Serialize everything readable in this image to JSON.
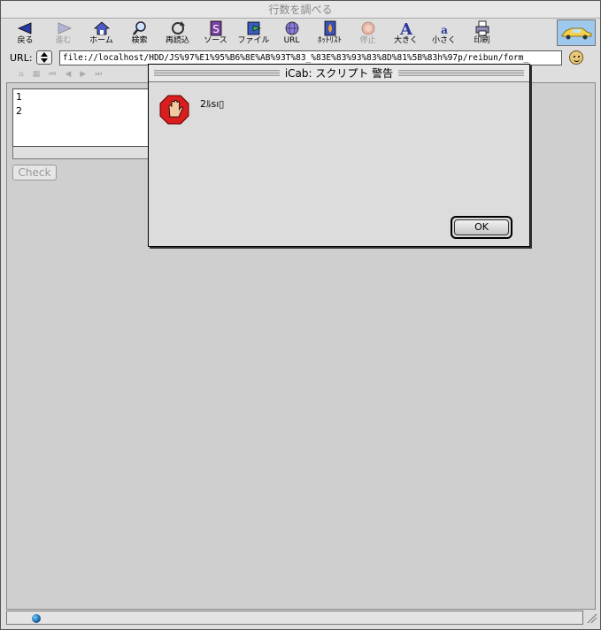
{
  "window": {
    "title": "行数を調べる"
  },
  "toolbar": {
    "buttons": [
      {
        "label": "戻る",
        "icon": "back-arrow-icon",
        "enabled": true
      },
      {
        "label": "進む",
        "icon": "forward-arrow-icon",
        "enabled": false
      },
      {
        "label": "ホーム",
        "icon": "home-icon",
        "enabled": true
      },
      {
        "label": "検索",
        "icon": "search-icon",
        "enabled": true
      },
      {
        "label": "再読込",
        "icon": "reload-icon",
        "enabled": true
      },
      {
        "label": "ソース",
        "icon": "source-icon",
        "enabled": true
      },
      {
        "label": "ファイル",
        "icon": "file-icon",
        "enabled": true
      },
      {
        "label": "URL",
        "icon": "globe-icon",
        "enabled": true
      },
      {
        "label": "ﾎｯﾄﾘｽﾄ",
        "icon": "hotlist-icon",
        "enabled": true
      },
      {
        "label": "停止",
        "icon": "stop-icon",
        "enabled": false
      },
      {
        "label": "大きく",
        "icon": "font-bigger-icon",
        "enabled": true
      },
      {
        "label": "小さく",
        "icon": "font-smaller-icon",
        "enabled": true
      },
      {
        "label": "印刷",
        "icon": "print-icon",
        "enabled": true
      }
    ],
    "brand_icon": "taxi-icon"
  },
  "urlbar": {
    "label": "URL:",
    "value": "file://localhost/HDD/JS%97%E1%95%B6%8E%AB%93T%83_%83E%83%93%83%8D%81%5B%83h%97p/reibun/form_"
  },
  "page": {
    "textarea_lines": [
      "1",
      "2"
    ],
    "check_label": "Check"
  },
  "dialog": {
    "title": "iCab: スクリプト 警告",
    "message": "2ﾙsı▯",
    "ok_label": "OK"
  },
  "colors": {
    "toolbar_bg": "#dedede",
    "content_bg": "#cfcfcf",
    "car_bg": "#9ec9ec"
  }
}
